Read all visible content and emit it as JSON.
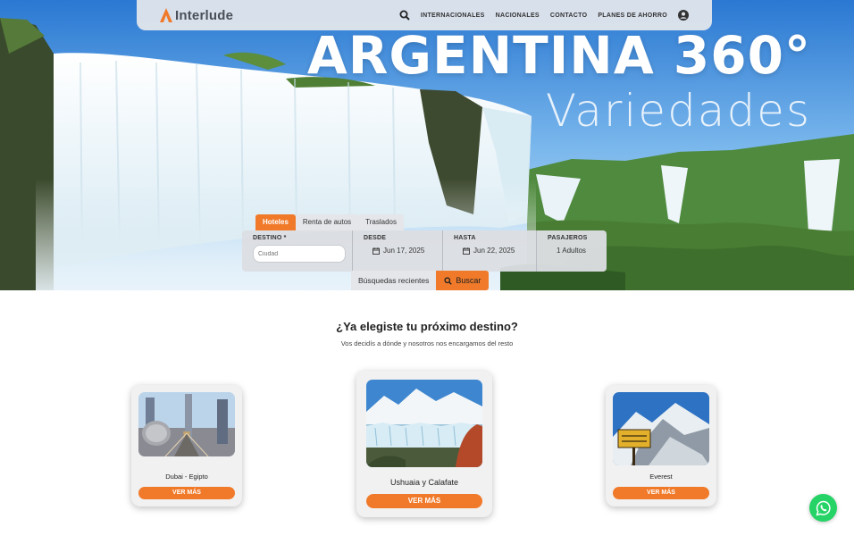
{
  "brand": {
    "name": "Interlude",
    "accent": "#f07a2a"
  },
  "nav": {
    "links": [
      "INTERNACIONALES",
      "NACIONALES",
      "CONTACTO",
      "PLANES DE AHORRO"
    ],
    "search_icon": "search-icon",
    "account_icon": "user-circle-icon"
  },
  "hero": {
    "title": "ARGENTINA 360°",
    "subtitle": "Variedades"
  },
  "search": {
    "tabs": [
      "Hoteles",
      "Renta de autos",
      "Traslados"
    ],
    "active_tab": "Hoteles",
    "destino_label": "DESTINO *",
    "destino_placeholder": "Ciudad",
    "desde_label": "DESDE",
    "desde_value": "Jun 17, 2025",
    "hasta_label": "HASTA",
    "hasta_value": "Jun 22, 2025",
    "pasajeros_label": "PASAJEROS",
    "pasajeros_value": "1 Adultos",
    "recent_label": "Búsquedas recientes",
    "search_button": "Buscar"
  },
  "destinations": {
    "title": "¿Ya elegiste tu próximo destino?",
    "subtitle": "Vos decidís a dónde y nosotros nos encargamos del resto",
    "cards": [
      {
        "name": "Dubai - Egipto",
        "button": "VER MÁS"
      },
      {
        "name": "Ushuaia y Calafate",
        "button": "VER MÁS"
      },
      {
        "name": "Everest",
        "button": "VER MÁS"
      }
    ]
  },
  "whatsapp_icon": "whatsapp-icon"
}
